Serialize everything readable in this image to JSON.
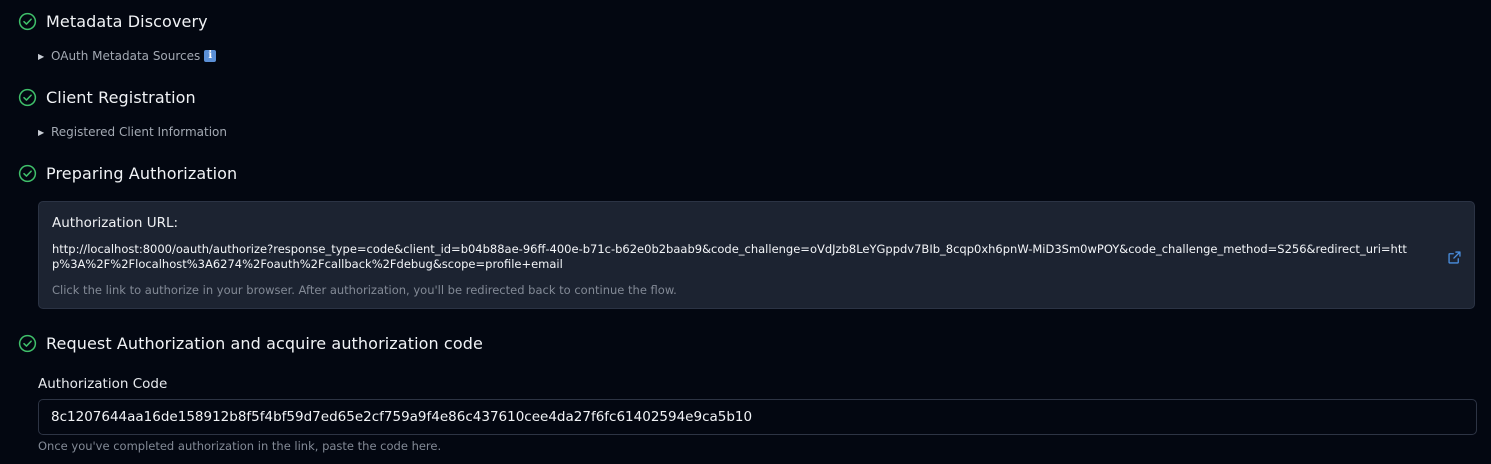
{
  "steps": [
    {
      "title": "Metadata Discovery",
      "details_label": "OAuth Metadata Sources",
      "details_emoji": "i"
    },
    {
      "title": "Client Registration",
      "details_label": "Registered Client Information"
    },
    {
      "title": "Preparing Authorization"
    },
    {
      "title": "Request Authorization and acquire authorization code"
    }
  ],
  "authorization": {
    "label": "Authorization URL:",
    "url": "http://localhost:8000/oauth/authorize?response_type=code&client_id=b04b88ae-96ff-400e-b71c-b62e0b2baab9&code_challenge=oVdJzb8LeYGppdv7BIb_8cqp0xh6pnW-MiD3Sm0wPOY&code_challenge_method=S256&redirect_uri=http%3A%2F%2Flocalhost%3A6274%2Foauth%2Fcallback%2Fdebug&scope=profile+email",
    "hint": "Click the link to authorize in your browser. After authorization, you'll be redirected back to continue the flow.",
    "open_icon": "external-link-icon"
  },
  "code_field": {
    "label": "Authorization Code",
    "value": "8c1207644aa16de158912b8f5f4bf59d7ed65e2cf759a9f4e86c437610cee4da27f6fc61402594e9ca5b10",
    "hint": "Once you've completed authorization in the link, paste the code here."
  },
  "colors": {
    "background": "#030711",
    "check_green": "#3fbf6a",
    "panel": "#1c2331",
    "link_blue": "#4a8fe0"
  },
  "icons": {
    "step_status": "check-circle-icon",
    "expand": "triangle-right-icon"
  }
}
